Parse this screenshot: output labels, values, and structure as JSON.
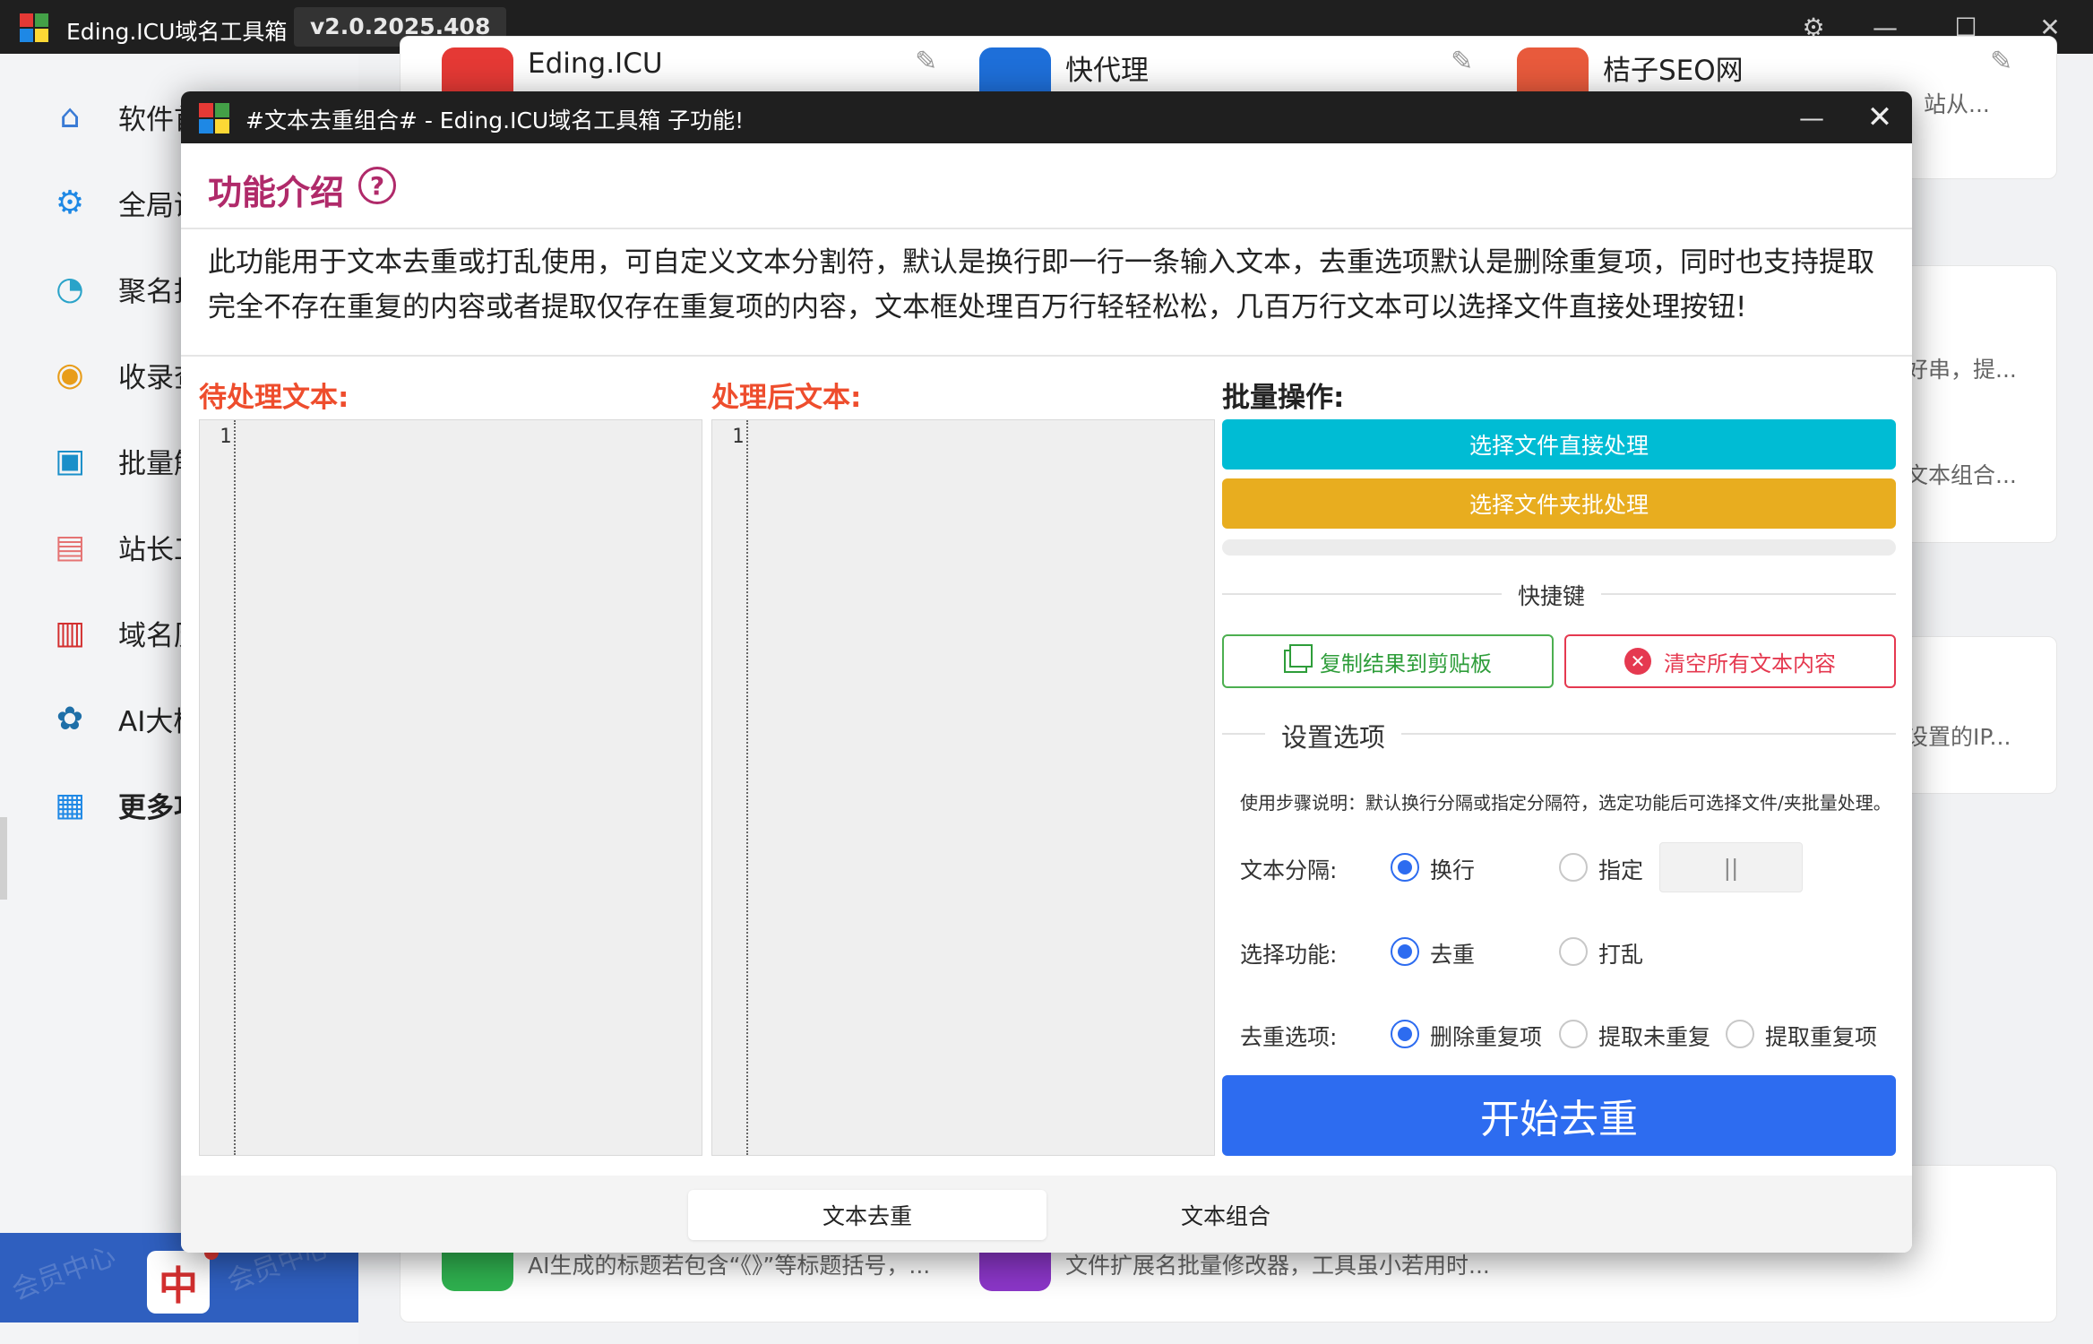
{
  "app": {
    "title": "Eding.ICU域名工具箱",
    "version": "v2.0.2025.408"
  },
  "sidebar": {
    "items": [
      {
        "label": "软件首"
      },
      {
        "label": "全局设"
      },
      {
        "label": "聚名批"
      },
      {
        "label": "收录查"
      },
      {
        "label": "批量解"
      },
      {
        "label": "站长工"
      },
      {
        "label": "域名历"
      },
      {
        "label": "AI大模"
      },
      {
        "label": "更多功"
      }
    ],
    "member_text": "会员中心"
  },
  "background_cards": {
    "row1": [
      {
        "title": "Eding.ICU",
        "desc": "",
        "color": "#e53935"
      },
      {
        "title": "快代理",
        "desc": "",
        "color": "#1e6fd9"
      },
      {
        "title": "桔子SEO网",
        "desc": "站从...",
        "color": "#e85a3c"
      }
    ],
    "right_snippets": [
      "好串，提...",
      "文本组合...",
      "设置的IP..."
    ],
    "bottom": [
      {
        "desc": "AI生成的标题若包含“《》”等标题括号，...",
        "color": "#2fb14f"
      },
      {
        "desc": "文件扩展名批量修改器，工具虽小若用时...",
        "color": "#8b36c8"
      }
    ]
  },
  "dialog": {
    "title": "#文本去重组合#  -  Eding.ICU域名工具箱 子功能!",
    "intro_title": "功能介绍",
    "intro_text": "此功能用于文本去重或打乱使用，可自定义文本分割符，默认是换行即一行一条输入文本，去重选项默认是删除重复项，同时也支持提取完全不存在重复的内容或者提取仅存在重复项的内容，文本框处理百万行轻轻松松，几百万行文本可以选择文件直接处理按钮!",
    "input_heading": "待处理文本:",
    "output_heading": "处理后文本:",
    "batch_heading": "批量操作:",
    "input_line": "1",
    "output_line": "1",
    "btn_file": "选择文件直接处理",
    "btn_folder": "选择文件夹批处理",
    "shortcut_label": "快捷键",
    "btn_copy": "复制结果到剪贴板",
    "btn_clear": "清空所有文本内容",
    "settings_label": "设置选项",
    "steps_text": "使用步骤说明：默认换行分隔或指定分隔符，选定功能后可选择文件/夹批量处理。",
    "separator": {
      "label": "文本分隔:",
      "options": [
        "换行",
        "指定"
      ],
      "selected": "换行",
      "custom_value": "||"
    },
    "function": {
      "label": "选择功能:",
      "options": [
        "去重",
        "打乱"
      ],
      "selected": "去重"
    },
    "dedup": {
      "label": "去重选项:",
      "options": [
        "删除重复项",
        "提取未重复",
        "提取重复项"
      ],
      "selected": "删除重复项"
    },
    "start_button": "开始去重",
    "tabs": [
      "文本去重",
      "文本组合"
    ],
    "active_tab": "文本去重"
  },
  "colors": {
    "accent_blue": "#2d6cf0",
    "cyan": "#00bcd4",
    "amber": "#e8ad1f",
    "heading_orange": "#ee4d2d",
    "intro_magenta": "#b02a6a",
    "copy_green": "#2e9d3a",
    "clear_red": "#e53950"
  }
}
